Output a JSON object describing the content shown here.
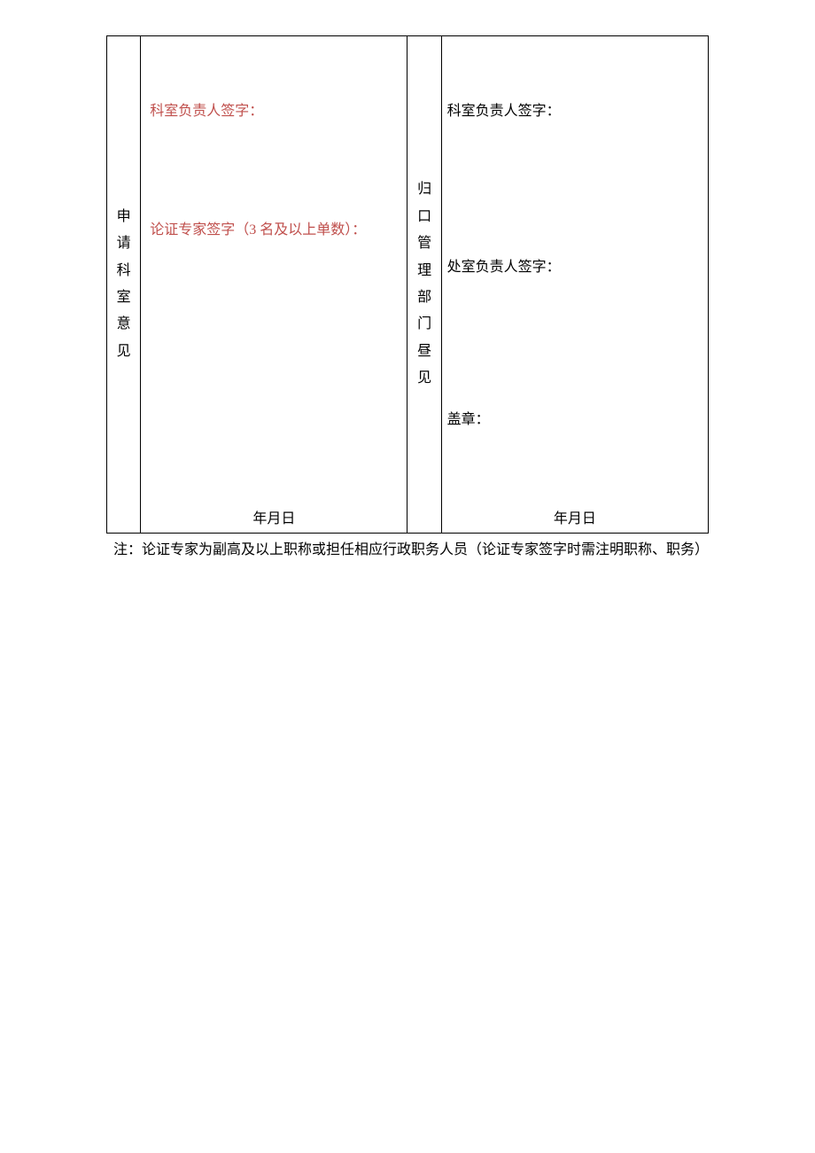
{
  "table": {
    "left_header_chars": [
      "申",
      "请",
      "科",
      "室",
      "意",
      "见"
    ],
    "right_header_chars": [
      "归",
      "口",
      "管",
      "理",
      "部",
      "门",
      "昼",
      "见"
    ],
    "left": {
      "dept_sign_label": "科室负责人签字：",
      "expert_sign_label": "论证专家签字（3 名及以上单数）：",
      "date_label": "年月日"
    },
    "right": {
      "dept_sign_label": "科室负责人签字：",
      "office_sign_label": "处室负责人签字：",
      "seal_label": "盖章：",
      "date_label": "年月日"
    }
  },
  "footnote": "注：论证专家为副高及以上职称或担任相应行政职务人员（论证专家签字时需注明职称、职务）"
}
